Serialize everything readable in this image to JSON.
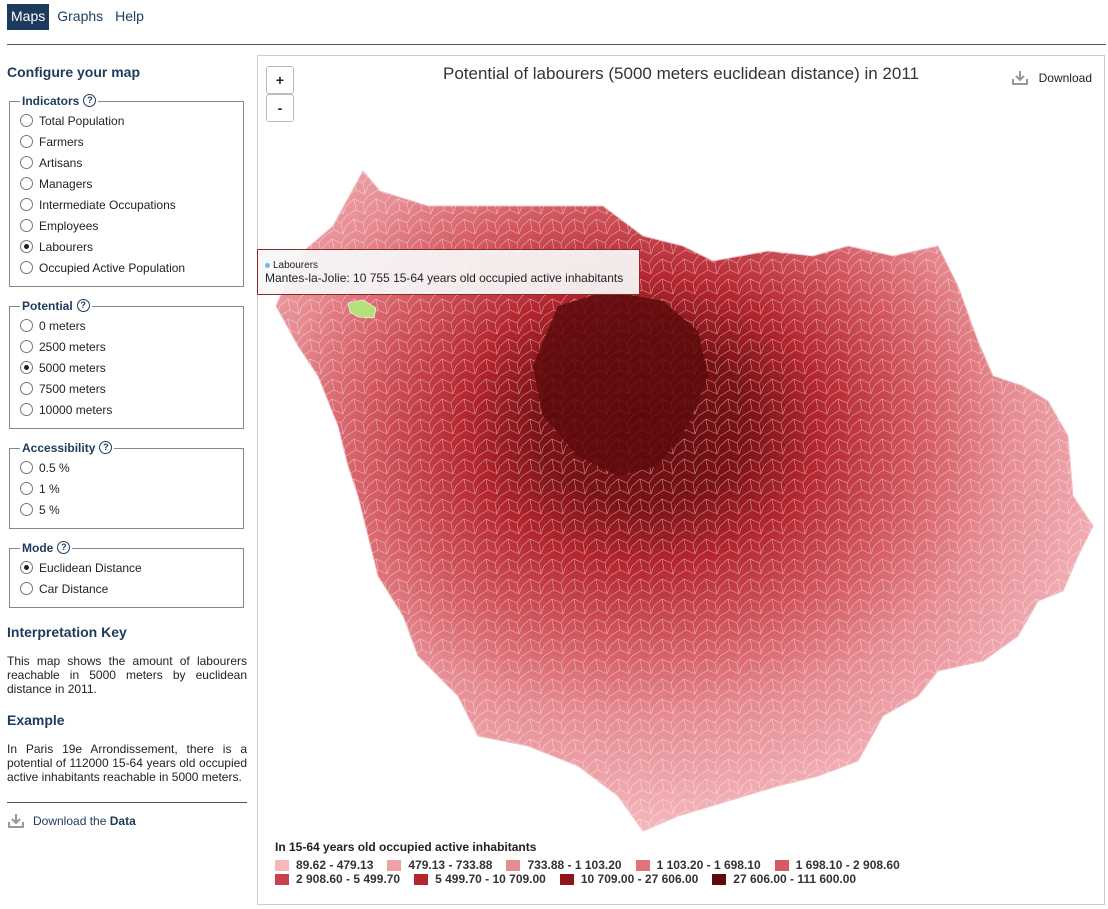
{
  "nav": {
    "tabs": [
      "Maps",
      "Graphs",
      "Help"
    ]
  },
  "sidebar": {
    "title": "Configure your map",
    "indicators": {
      "legend": "Indicators",
      "options": [
        "Total Population",
        "Farmers",
        "Artisans",
        "Managers",
        "Intermediate Occupations",
        "Employees",
        "Labourers",
        "Occupied Active Population"
      ],
      "selected": "Labourers"
    },
    "potential": {
      "legend": "Potential",
      "options": [
        "0 meters",
        "2500 meters",
        "5000 meters",
        "7500 meters",
        "10000 meters"
      ],
      "selected": "5000 meters"
    },
    "accessibility": {
      "legend": "Accessibility",
      "options": [
        "0.5 %",
        "1 %",
        "5 %"
      ]
    },
    "mode": {
      "legend": "Mode",
      "options": [
        "Euclidean Distance",
        "Car Distance"
      ],
      "selected": "Euclidean Distance"
    },
    "interpretation_title": "Interpretation Key",
    "interpretation_text": "This map shows the amount of labourers reachable in 5000 meters by euclidean distance in 2011.",
    "example_title": "Example",
    "example_text": "In Paris 19e Arrondissement, there is a potential of 112000 15-64 years old occupied active inhabitants reachable in 5000 meters.",
    "download_prefix": "Download the",
    "download_bold": "Data"
  },
  "map": {
    "zoom_in": "+",
    "zoom_out": "-",
    "title": "Potential of labourers (5000 meters euclidean distance) in 2011",
    "download_label": "Download",
    "tooltip": {
      "series": "Labourers",
      "text": "Mantes-la-Jolie: 10 755 15-64 years old occupied active inhabitants"
    },
    "legend_title": "In 15-64 years old occupied active inhabitants",
    "legend": [
      {
        "label": "89.62 - 479.13",
        "color": "#f4b8bd"
      },
      {
        "label": "479.13 - 733.88",
        "color": "#eea2a8"
      },
      {
        "label": "733.88 - 1 103.20",
        "color": "#e68b92"
      },
      {
        "label": "1 103.20 - 1 698.10",
        "color": "#de747c"
      },
      {
        "label": "1 698.10 - 2 908.60",
        "color": "#d45a62"
      },
      {
        "label": "2 908.60 - 5 499.70",
        "color": "#c8414b"
      },
      {
        "label": "5 499.70 - 10 709.00",
        "color": "#b4262f"
      },
      {
        "label": "10 709.00 - 27 606.00",
        "color": "#8e1519"
      },
      {
        "label": "27 606.00 - 111 600.00",
        "color": "#5e0b0d"
      }
    ],
    "highlight_color": "#b4e07a"
  }
}
